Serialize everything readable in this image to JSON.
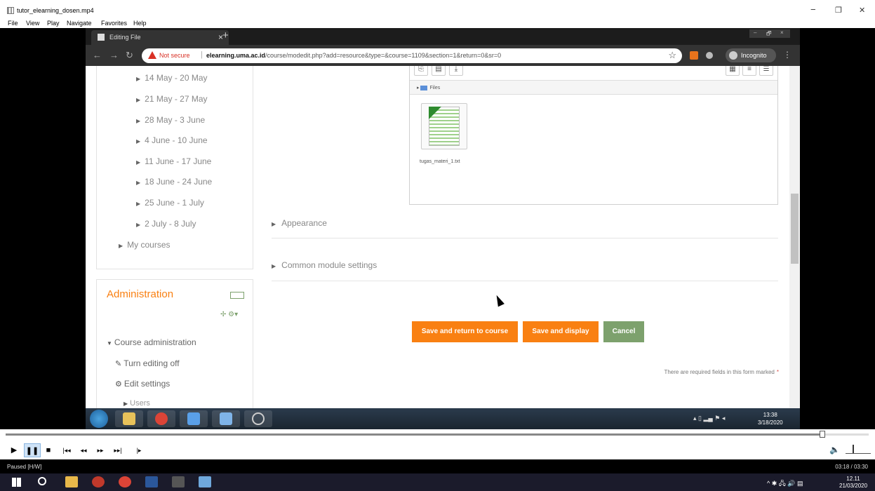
{
  "player": {
    "title": "tutor_elearning_dosen.mp4",
    "menu": [
      "File",
      "View",
      "Play",
      "Navigate",
      "Favorites",
      "Help"
    ],
    "window_controls": [
      "−",
      "❐",
      "✕"
    ],
    "status": "Paused [H/W]",
    "time": "03:18 / 03:30",
    "progress": 0.943
  },
  "browser": {
    "tab_title": "Editing File",
    "tab_close": "×",
    "new_tab": "+",
    "window_controls": [
      "–",
      "🗗",
      "×"
    ],
    "not_secure": "Not secure",
    "url_domain": "elearning.uma.ac.id",
    "url_path": "/course/modedit.php?add=resource&type=&course=1109&section=1&return=0&sr=0",
    "incognito": "Incognito"
  },
  "sidebar": {
    "weeks": [
      "14 May - 20 May",
      "21 May - 27 May",
      "28 May - 3 June",
      "4 June - 10 June",
      "11 June - 17 June",
      "18 June - 24 June",
      "25 June - 1 July",
      "2 July - 8 July"
    ],
    "my_courses": "My courses",
    "administration": {
      "title": "Administration",
      "course_admin": "Course administration",
      "turn_editing_off": "Turn editing off",
      "edit_settings": "Edit settings",
      "users": "Users"
    }
  },
  "filepicker": {
    "path_label": "Files",
    "file_name": "tugas_materi_1.txt"
  },
  "sections": {
    "appearance": "Appearance",
    "common_module_settings": "Common module settings"
  },
  "buttons": {
    "save_return": "Save and return to course",
    "save_display": "Save and display",
    "cancel": "Cancel"
  },
  "required_note": "There are required fields in this form marked",
  "required_mark": "*",
  "win7": {
    "time": "13:38",
    "date": "3/18/2020"
  },
  "win10": {
    "time": "12.11",
    "date": "21/03/2020"
  },
  "colors": {
    "moodle_orange": "#f98012",
    "moodle_green": "#7da16d"
  }
}
